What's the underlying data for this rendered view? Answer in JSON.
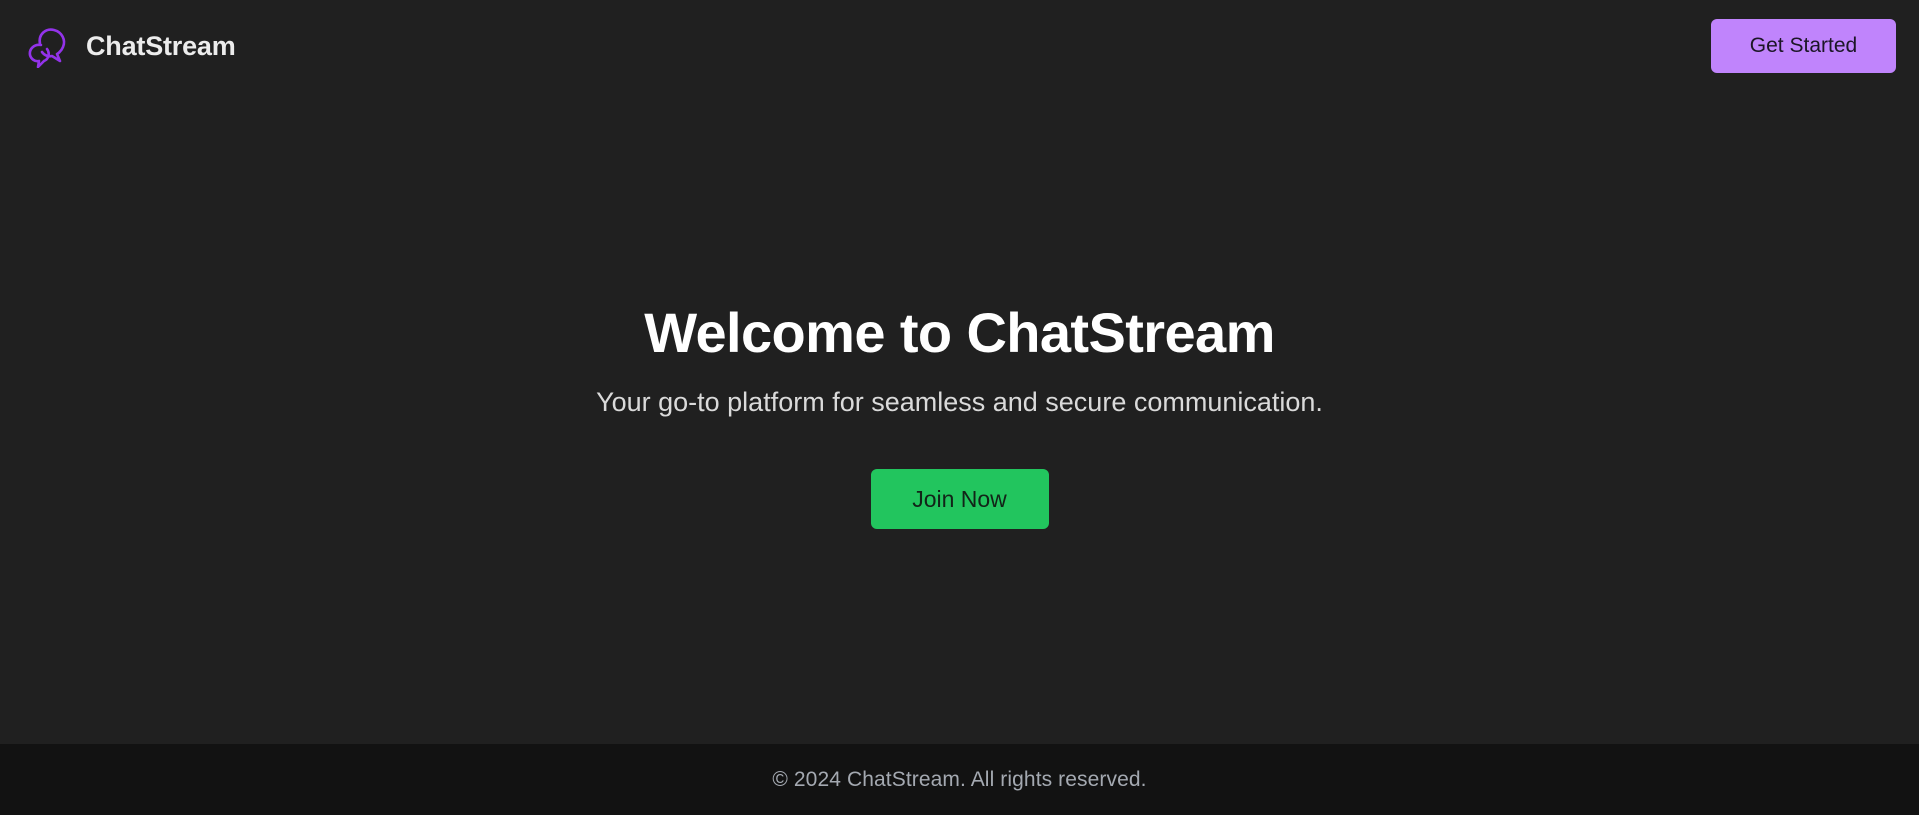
{
  "header": {
    "brand_name": "ChatStream",
    "brand_icon": "chat-bubbles-icon",
    "get_started_label": "Get Started"
  },
  "hero": {
    "title": "Welcome to ChatStream",
    "subtitle": "Your go-to platform for seamless and secure communication.",
    "join_label": "Join Now"
  },
  "footer": {
    "copyright": "© 2024 ChatStream. All rights reserved."
  },
  "colors": {
    "background": "#202020",
    "footer_background": "#121212",
    "brand_accent": "#9333ea",
    "get_started_button": "#c084fc",
    "join_button": "#22c55e"
  }
}
